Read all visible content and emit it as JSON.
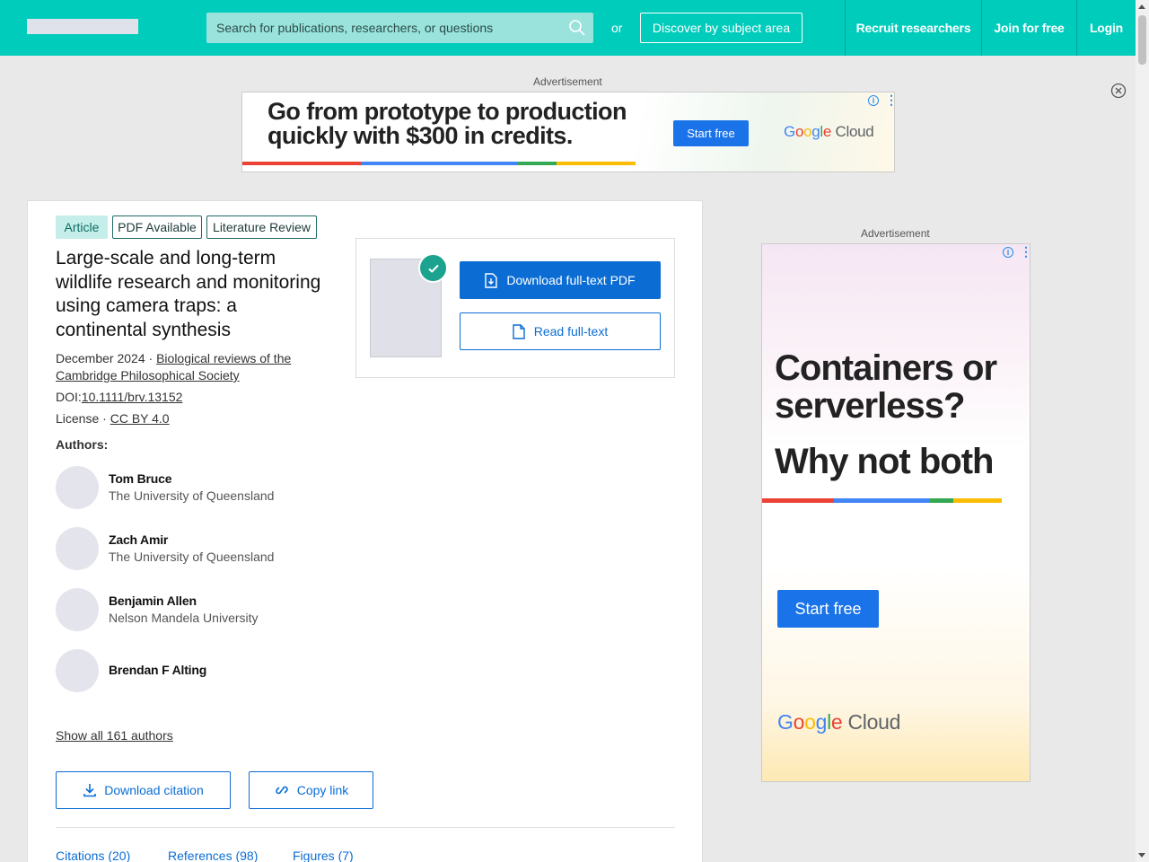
{
  "header": {
    "search_placeholder": "Search for publications, researchers, or questions",
    "or_text": "or",
    "discover_label": "Discover by subject area",
    "nav": [
      "Recruit researchers",
      "Join for free",
      "Login"
    ]
  },
  "ads": {
    "label": "Advertisement",
    "banner": {
      "headline": "Go from prototype to production quickly with $300 in credits.",
      "button": "Start free",
      "brand": "Google Cloud"
    },
    "side": {
      "headline": "Containers or serverless?",
      "headline2": "Why not both",
      "button": "Start free",
      "brand": "Google Cloud"
    }
  },
  "article": {
    "tags": [
      "Article",
      "PDF Available",
      "Literature Review"
    ],
    "title": "Large-scale and long-term wildlife research and monitoring using camera traps: a continental synthesis",
    "date": "December 2024",
    "separator": " · ",
    "journal": "Biological reviews of the Cambridge Philosophical Society",
    "doi_label": "DOI:",
    "doi": "10.1111/brv.13152",
    "license_label": "License · ",
    "license": "CC BY 4.0",
    "authors_label": "Authors:",
    "authors": [
      {
        "name": "Tom Bruce",
        "institution": "The University of Queensland"
      },
      {
        "name": "Zach Amir",
        "institution": "The University of Queensland"
      },
      {
        "name": "Benjamin Allen",
        "institution": "Nelson Mandela University"
      },
      {
        "name": "Brendan F Alting",
        "institution": ""
      }
    ],
    "show_all": "Show all 161 authors",
    "download_citation": "Download citation",
    "copy_link": "Copy link",
    "download_pdf": "Download full-text PDF",
    "read_fulltext": "Read full-text",
    "tabs": [
      "Citations (20)",
      "References (98)",
      "Figures (7)"
    ]
  },
  "colors": {
    "header": "#00ccbb",
    "primary_button": "#0b6dd3",
    "check_badge": "#1ba38f"
  }
}
